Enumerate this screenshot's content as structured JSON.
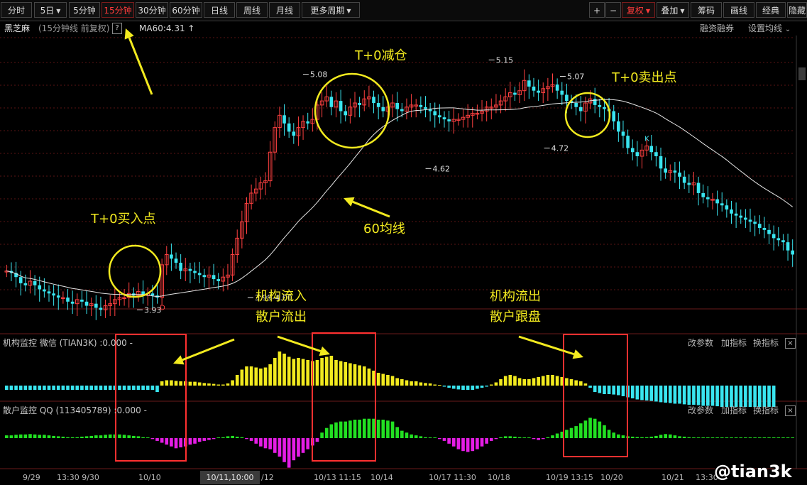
{
  "toolbar": {
    "periods": [
      "分时",
      "5日",
      "5分钟",
      "15分钟",
      "30分钟",
      "60分钟",
      "日线",
      "周线",
      "月线",
      "更多周期"
    ],
    "active_period": "15分钟",
    "right_buttons": [
      "+",
      "−",
      "复权",
      "叠加",
      "筹码",
      "画线",
      "经典",
      "隐藏"
    ]
  },
  "info": {
    "stock": "黑芝麻",
    "period_note": "(15分钟线 前复权)",
    "help": "?",
    "ma_label": "MA60:4.31",
    "ma_arrow": "↑",
    "margin": "融资融券",
    "set_ma": "设置均线"
  },
  "panels": {
    "inst": {
      "name": "机构监控 微信 (TIAN3K) :0.000 -",
      "buttons": [
        "改参数",
        "加指标",
        "换指标"
      ],
      "close": "×"
    },
    "retail": {
      "name": "散户监控 QQ (113405789) :0.000 -",
      "buttons": [
        "改参数",
        "加指标",
        "换指标"
      ],
      "close": "×"
    }
  },
  "annotations": {
    "buy": "T+0买入点",
    "reduce": "T+0减仓",
    "sell": "T+0卖出点",
    "ma60": "60均线",
    "inst_in": "机构流入",
    "retail_out": "散户流出",
    "inst_out": "机构流出",
    "retail_follow": "散户跟盘",
    "marker_d": "D",
    "marker_k": "K"
  },
  "xaxis": {
    "labels": [
      "9/29",
      "13:30 9/30",
      "10/10",
      "/12",
      "10/13 11:15",
      "10/14",
      "10/17 11:30",
      "10/18",
      "10/19 13:15",
      "10/20",
      "10/21",
      "13:30"
    ],
    "selected": "10/11,10:00"
  },
  "watermark": "@tian3k",
  "colors": {
    "up": "#ff4040",
    "down": "#39e5f0",
    "ma": "#e6e6e6",
    "yellow": "#f2ea1f",
    "green": "#22e022",
    "magenta": "#e51de5",
    "box": "#ff3030"
  },
  "chart_data": {
    "type": "candlestick",
    "price_labels": [
      {
        "text": "3.93",
        "value": 3.93
      },
      {
        "text": "3.99-4.00",
        "value": 3.99
      },
      {
        "text": "5.08",
        "value": 5.08
      },
      {
        "text": "4.62",
        "value": 4.62
      },
      {
        "text": "5.15",
        "value": 5.15
      },
      {
        "text": "5.07",
        "value": 5.07
      },
      {
        "text": "4.72",
        "value": 4.72
      }
    ],
    "ma60_label": "MA60:4.31",
    "price_range": [
      3.9,
      5.2
    ],
    "candles_close": [
      4.12,
      4.11,
      4.09,
      4.06,
      4.05,
      4.07,
      4.05,
      4.03,
      4.02,
      4.01,
      4.0,
      3.99,
      3.99,
      3.97,
      3.96,
      3.98,
      3.97,
      3.95,
      3.96,
      3.94,
      3.93,
      3.95,
      3.96,
      3.98,
      3.99,
      3.99,
      4.01,
      4.0,
      4.02,
      4.0,
      4.01,
      4.0,
      3.99,
      4.15,
      4.2,
      4.18,
      4.16,
      4.12,
      4.13,
      4.12,
      4.11,
      4.1,
      4.09,
      4.1,
      4.08,
      4.07,
      4.09,
      4.1,
      4.2,
      4.28,
      4.36,
      4.45,
      4.5,
      4.52,
      4.55,
      4.56,
      4.7,
      4.82,
      4.88,
      4.84,
      4.8,
      4.78,
      4.82,
      4.85,
      4.84,
      4.86,
      4.93,
      4.95,
      4.97,
      4.92,
      4.95,
      4.9,
      4.88,
      4.92,
      4.94,
      4.93,
      4.96,
      4.97,
      4.94,
      4.92,
      4.9,
      4.92,
      4.94,
      4.91,
      4.9,
      4.92,
      4.93,
      4.93,
      4.92,
      4.91,
      4.9,
      4.88,
      4.87,
      4.86,
      4.85,
      4.86,
      4.86,
      4.87,
      4.88,
      4.89,
      4.89,
      4.9,
      4.92,
      4.92,
      4.93,
      4.95,
      4.97,
      4.99,
      4.98,
      5.0,
      5.05,
      5.02,
      5.0,
      4.99,
      5.01,
      5.02,
      5.03,
      5.0,
      4.98,
      4.95,
      4.94,
      4.92,
      4.9,
      4.94,
      4.96,
      4.93,
      4.92,
      4.91,
      4.9,
      4.85,
      4.8,
      4.78,
      4.72,
      4.7,
      4.68,
      4.71,
      4.73,
      4.7,
      4.68,
      4.62,
      4.6,
      4.61,
      4.6,
      4.58,
      4.55,
      4.54,
      4.55,
      4.5,
      4.48,
      4.47,
      4.47,
      4.45,
      4.44,
      4.42,
      4.4,
      4.39,
      4.38,
      4.37,
      4.36,
      4.35,
      4.33,
      4.32,
      4.3,
      4.28,
      4.27,
      4.26,
      4.22,
      4.2
    ],
    "indicators": [
      {
        "name": "机构监控",
        "values": [
          -0.2,
          -0.2,
          -0.2,
          -0.2,
          -0.2,
          -0.2,
          -0.2,
          -0.2,
          -0.2,
          -0.2,
          -0.2,
          -0.2,
          -0.2,
          -0.2,
          -0.2,
          -0.2,
          -0.2,
          -0.2,
          -0.2,
          -0.2,
          -0.2,
          -0.2,
          -0.2,
          -0.2,
          -0.2,
          -0.2,
          -0.2,
          -0.2,
          -0.2,
          -0.2,
          -0.2,
          -0.2,
          -0.3,
          0.2,
          0.25,
          0.25,
          0.22,
          0.2,
          0.2,
          0.18,
          0.18,
          0.15,
          0.12,
          0.1,
          0.08,
          0.05,
          0.05,
          0.1,
          0.25,
          0.5,
          0.75,
          0.9,
          0.9,
          0.85,
          0.8,
          0.85,
          1.0,
          1.3,
          1.6,
          1.5,
          1.35,
          1.25,
          1.3,
          1.25,
          1.2,
          1.15,
          1.2,
          1.3,
          1.35,
          1.4,
          1.2,
          1.15,
          1.1,
          1.05,
          1.0,
          0.95,
          0.9,
          0.8,
          0.7,
          0.6,
          0.55,
          0.5,
          0.45,
          0.35,
          0.3,
          0.25,
          0.2,
          0.2,
          0.15,
          0.12,
          0.1,
          0.05,
          0.02,
          -0.05,
          -0.1,
          -0.15,
          -0.18,
          -0.2,
          -0.2,
          -0.2,
          -0.15,
          -0.1,
          -0.05,
          0.05,
          0.15,
          0.3,
          0.45,
          0.5,
          0.45,
          0.35,
          0.3,
          0.3,
          0.35,
          0.4,
          0.45,
          0.5,
          0.5,
          0.45,
          0.4,
          0.35,
          0.3,
          0.25,
          0.2,
          0.1,
          -0.1,
          -0.3,
          -0.35,
          -0.4,
          -0.4,
          -0.42,
          -0.45,
          -0.5,
          -0.55,
          -0.6,
          -0.65,
          -0.68,
          -0.7,
          -0.72,
          -0.75,
          -0.78,
          -0.8,
          -0.82,
          -0.85,
          -0.85,
          -0.88,
          -0.9,
          -0.9,
          -0.92,
          -0.95,
          -0.95,
          -0.95,
          -0.97,
          -1.0,
          -1.0,
          -1.0,
          -1.0,
          -1.0,
          -1.0,
          -1.0,
          -1.0,
          -1.0,
          -1.0,
          -1.0,
          -1.0
        ]
      },
      {
        "name": "散户监控",
        "values": [
          0.15,
          0.15,
          0.18,
          0.2,
          0.2,
          0.22,
          0.2,
          0.18,
          0.18,
          0.15,
          0.12,
          0.1,
          0.08,
          0.05,
          0.05,
          0.05,
          0.08,
          0.1,
          0.12,
          0.15,
          0.15,
          0.18,
          0.2,
          0.2,
          0.2,
          0.18,
          0.15,
          0.12,
          0.1,
          0.05,
          0.02,
          -0.05,
          -0.15,
          -0.25,
          -0.35,
          -0.45,
          -0.55,
          -0.5,
          -0.45,
          -0.35,
          -0.3,
          -0.2,
          -0.15,
          -0.1,
          -0.05,
          0.02,
          0.05,
          0.1,
          0.12,
          0.08,
          0.05,
          -0.05,
          -0.15,
          -0.3,
          -0.45,
          -0.55,
          -0.6,
          -0.8,
          -1.0,
          -1.3,
          -1.6,
          -1.2,
          -1.0,
          -0.8,
          -0.6,
          -0.4,
          -0.2,
          0.3,
          0.55,
          0.75,
          0.85,
          0.9,
          0.9,
          0.95,
          1.0,
          1.0,
          1.05,
          1.05,
          1.05,
          1.0,
          1.0,
          0.95,
          0.9,
          0.6,
          0.4,
          0.3,
          0.2,
          0.15,
          0.1,
          0.05,
          0.02,
          0.0,
          -0.05,
          -0.15,
          -0.3,
          -0.45,
          -0.6,
          -0.7,
          -0.75,
          -0.7,
          -0.6,
          -0.45,
          -0.3,
          -0.15,
          -0.05,
          0.05,
          0.1,
          0.1,
          0.08,
          0.05,
          0.02,
          0.0,
          -0.05,
          -0.1,
          -0.05,
          0.05,
          0.15,
          0.25,
          0.35,
          0.45,
          0.55,
          0.65,
          0.8,
          0.95,
          1.1,
          1.05,
          0.9,
          0.7,
          0.45,
          0.3,
          0.2,
          0.15,
          0.1,
          0.08,
          0.06,
          0.05,
          0.05,
          0.08,
          0.12,
          0.18,
          0.22,
          0.2,
          0.15,
          0.1,
          0.08,
          0.05,
          0.04,
          0.03,
          0.02,
          0.02,
          0.02,
          0.02,
          0.02,
          0.02,
          0.02,
          0.02,
          0.02,
          0.02,
          0.02,
          0.02,
          0.02,
          0.02,
          0.02,
          0.02,
          0.02,
          0.02,
          0.02,
          0.02
        ]
      }
    ]
  }
}
